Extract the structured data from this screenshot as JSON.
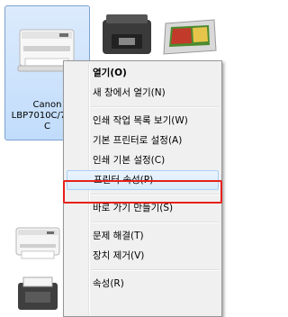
{
  "devices": [
    {
      "label": "Canon\nLBP7010C/7018\nC",
      "selected": true
    }
  ],
  "context_menu": {
    "items": [
      {
        "label": "열기(O)",
        "bold": true
      },
      {
        "label": "새 창에서 열기(N)"
      },
      {
        "label": "인쇄 작업 목록 보기(W)"
      },
      {
        "label": "기본 프린터로 설정(A)"
      },
      {
        "label": "인쇄 기본 설정(C)"
      },
      {
        "label": "프린터 속성(P)",
        "highlighted": true
      },
      {
        "label": "바로 가기 만들기(S)"
      },
      {
        "label": "문제 해결(T)"
      },
      {
        "label": "장치 제거(V)"
      },
      {
        "label": "속성(R)"
      }
    ]
  },
  "colors": {
    "highlight_box": "#e8201a",
    "selection_bg": "#cce4fb"
  }
}
